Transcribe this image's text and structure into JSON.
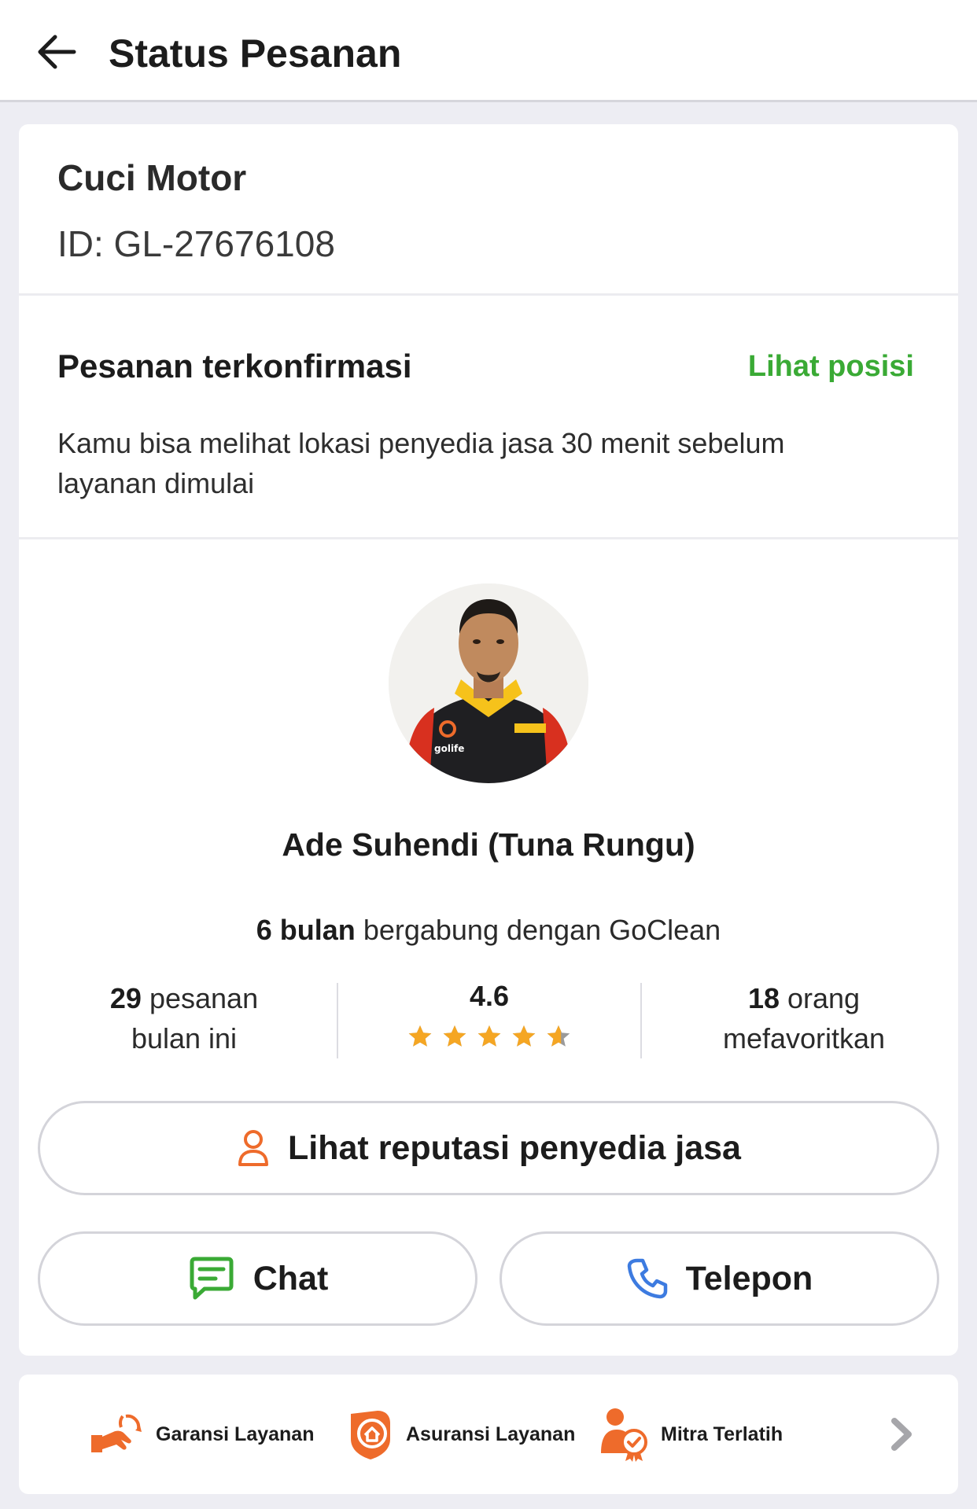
{
  "header": {
    "title": "Status Pesanan",
    "back_icon": "arrow-left-icon"
  },
  "order": {
    "service": "Cuci Motor",
    "id": "ID: GL-27676108"
  },
  "status": {
    "title": "Pesanan terkonfirmasi",
    "link": "Lihat posisi",
    "description": "Kamu bisa melihat lokasi penyedia jasa 30 menit sebelum layanan dimulai"
  },
  "provider": {
    "name": "Ade Suhendi (Tuna Rungu)",
    "tenure_value": "6 bulan",
    "tenure_text": " bergabung dengan GoClean",
    "orders_value": "29",
    "orders_text_1": " pesanan",
    "orders_text_2": "bulan ini",
    "rating": "4.6",
    "rating_fraction": 0.92,
    "stars_total": 5,
    "fav_value": "18",
    "fav_text_1": " orang",
    "fav_text_2": "mefavoritkan",
    "vest_logo_text": "golife"
  },
  "buttons": {
    "reputation": "Lihat reputasi penyedia jasa",
    "chat": "Chat",
    "call": "Telepon"
  },
  "features": [
    {
      "label": "Garansi Layanan",
      "icon": "handshake-refresh-icon"
    },
    {
      "label": "Asuransi Layanan",
      "icon": "shield-home-icon"
    },
    {
      "label": "Mitra Terlatih",
      "icon": "certified-person-icon"
    }
  ],
  "colors": {
    "accent_green": "#3aaa35",
    "star": "#f5a623",
    "star_empty": "#9a9a9a",
    "icon_orange": "#ee6b2b",
    "phone_blue": "#3d7be0",
    "background": "#ededf3"
  }
}
